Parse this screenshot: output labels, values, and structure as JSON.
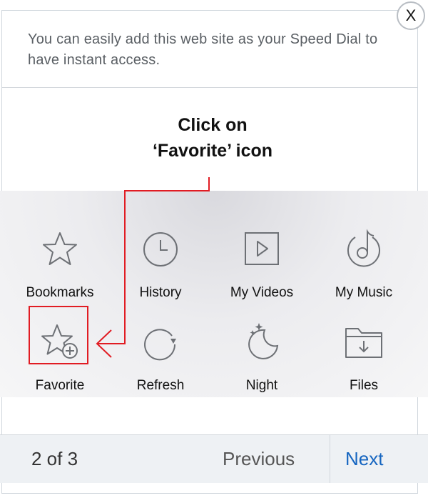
{
  "close_label": "X",
  "message": "You can easily add this web site as your Speed Dial to have instant access.",
  "callout": {
    "line1": "Click on",
    "line2": "‘Favorite’ icon"
  },
  "grid": {
    "row1": [
      {
        "label": "Bookmarks",
        "icon": "star-icon"
      },
      {
        "label": "History",
        "icon": "clock-icon"
      },
      {
        "label": "My Videos",
        "icon": "video-play-icon"
      },
      {
        "label": "My Music",
        "icon": "music-disc-icon"
      }
    ],
    "row2": [
      {
        "label": "Favorite",
        "icon": "star-add-icon"
      },
      {
        "label": "Refresh",
        "icon": "refresh-icon"
      },
      {
        "label": "Night",
        "icon": "moon-stars-icon"
      },
      {
        "label": "Files",
        "icon": "folder-download-icon"
      }
    ]
  },
  "footer": {
    "page_count": "2 of 3",
    "previous": "Previous",
    "next": "Next"
  },
  "colors": {
    "accent_red": "#e11c23",
    "link_blue": "#1565c0",
    "icon_gray": "#6d7075"
  }
}
